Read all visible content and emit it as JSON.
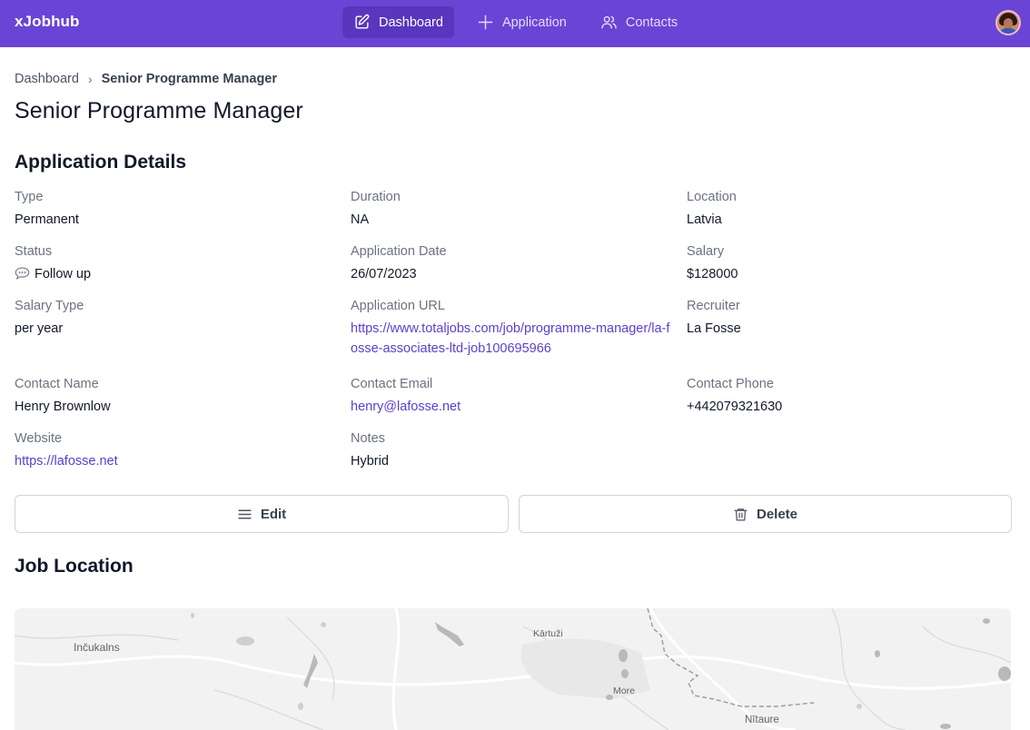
{
  "app": {
    "brand": "xJobhub"
  },
  "nav": {
    "items": [
      {
        "label": "Dashboard",
        "icon": "edit-square-icon",
        "active": true
      },
      {
        "label": "Application",
        "icon": "plus-icon",
        "active": false
      },
      {
        "label": "Contacts",
        "icon": "users-icon",
        "active": false
      }
    ]
  },
  "breadcrumb": {
    "parent": "Dashboard",
    "separator": "›",
    "current": "Senior Programme Manager"
  },
  "page": {
    "title": "Senior Programme Manager"
  },
  "details": {
    "section_title": "Application Details",
    "fields": [
      {
        "label": "Type",
        "value": "Permanent"
      },
      {
        "label": "Duration",
        "value": "NA"
      },
      {
        "label": "Location",
        "value": "Latvia"
      },
      {
        "label": "Status",
        "value": "Follow up"
      },
      {
        "label": "Application Date",
        "value": "26/07/2023"
      },
      {
        "label": "Salary",
        "value": "$128000"
      },
      {
        "label": "Salary Type",
        "value": "per year"
      },
      {
        "label": "Application URL",
        "value": "https://www.totaljobs.com/job/programme-manager/la-fosse-associates-ltd-job100695966"
      },
      {
        "label": "Recruiter",
        "value": "La Fosse"
      },
      {
        "label": "Contact Name",
        "value": "Henry Brownlow"
      },
      {
        "label": "Contact Email",
        "value": "henry@lafosse.net"
      },
      {
        "label": "Contact Phone",
        "value": "+442079321630"
      },
      {
        "label": "Website",
        "value": "https://lafosse.net"
      },
      {
        "label": "Notes",
        "value": "Hybrid"
      }
    ]
  },
  "actions": {
    "edit_label": "Edit",
    "delete_label": "Delete"
  },
  "map": {
    "section_title": "Job Location",
    "labels": [
      "Inčukalns",
      "Kārtuži",
      "More",
      "Nītaure"
    ]
  },
  "colors": {
    "header": "#6a44d4",
    "nav_active": "#5a36bf",
    "link": "#5b3fd0",
    "map_bg": "#f2f2f2"
  }
}
